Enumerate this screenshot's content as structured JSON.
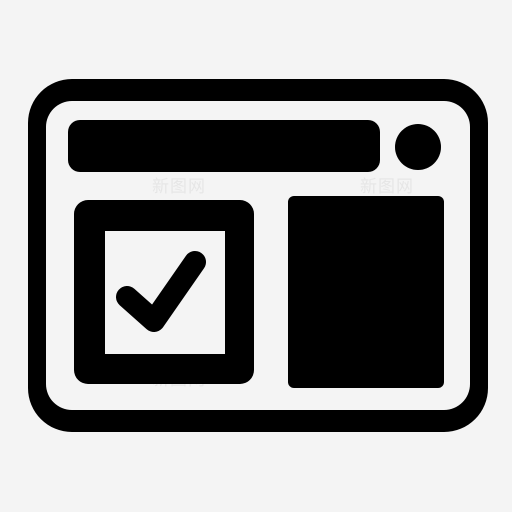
{
  "icon": {
    "name": "browser-window-checkbox-icon",
    "fill_color": "#000000",
    "background_color": "#f4f4f4"
  },
  "watermark": {
    "text": "新图网"
  }
}
